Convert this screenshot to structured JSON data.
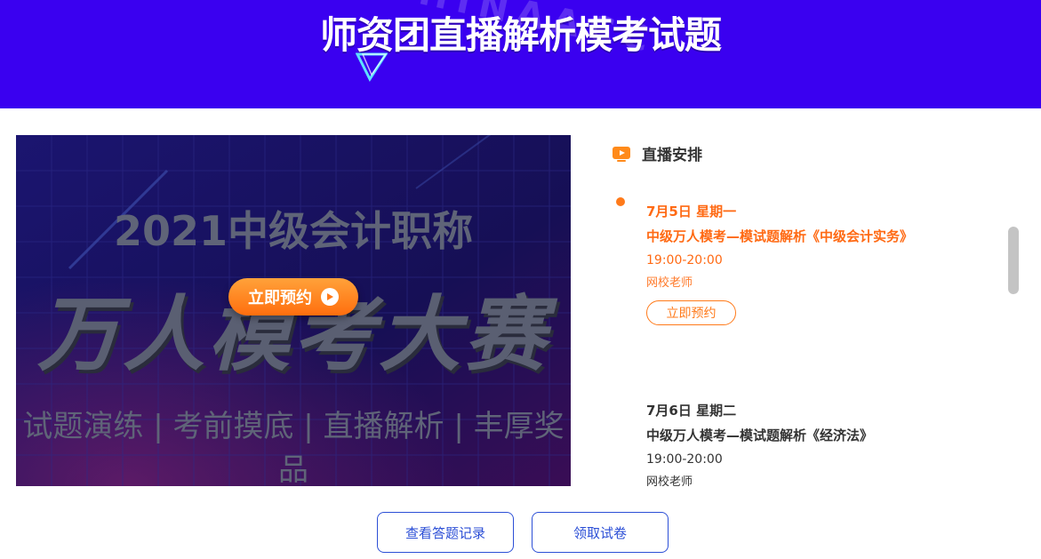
{
  "header": {
    "title": "师资团直播解析模考试题",
    "ghost": "CHINAACC",
    "bg_color": "#3a00f0"
  },
  "banner": {
    "year_line": "2021中级会计职称",
    "big_line": "万人模考大赛",
    "sub_line": "试题演练 | 考前摸底 | 直播解析 | 丰厚奖品",
    "cta_label": "立即预约",
    "cta_icon": "play-circle-icon"
  },
  "schedule": {
    "title": "直播安排",
    "icon": "tv-play-icon",
    "items": [
      {
        "date": "7月5日  星期一",
        "name": "中级万人模考—模试题解析《中级会计实务》",
        "time": "19:00-20:00",
        "teacher": "网校老师",
        "reserve_label": "立即预约"
      },
      {
        "date": "7月6日  星期二",
        "name": "中级万人模考—模试题解析《经济法》",
        "time": "19:00-20:00",
        "teacher": "网校老师"
      }
    ]
  },
  "actions": {
    "records_label": "查看答题记录",
    "paper_label": "领取试卷"
  },
  "colors": {
    "accent": "#ff6a14",
    "link": "#2c4fd6"
  }
}
